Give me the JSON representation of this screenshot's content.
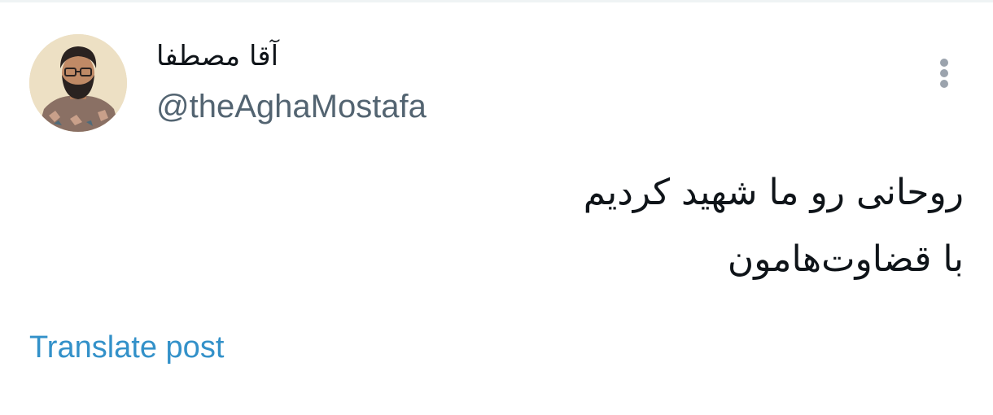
{
  "author": {
    "display_name": "آقا مصطفا",
    "handle": "@theAghaMostafa"
  },
  "menu": {
    "icon": "more-vertical-icon"
  },
  "post": {
    "lines": [
      "روحانی رو ما شهید کردیم",
      "با قضاوت‌هامون"
    ]
  },
  "actions": {
    "translate_label": "Translate post"
  },
  "colors": {
    "text_primary": "#0f1419",
    "text_secondary": "#536471",
    "link": "#3391c9",
    "menu_dots": "#9ba3ad",
    "border": "#eff3f4"
  }
}
